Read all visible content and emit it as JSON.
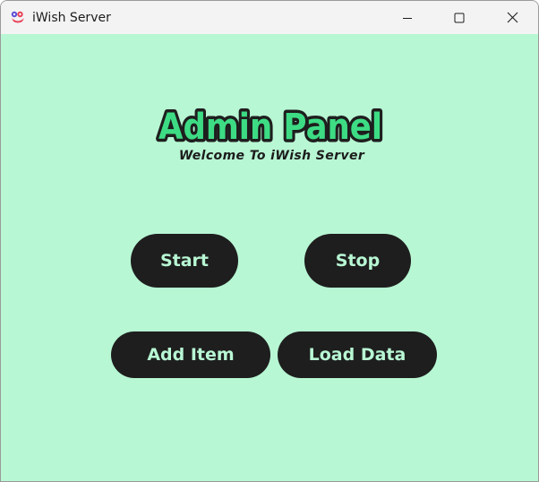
{
  "window": {
    "title": "iWish Server",
    "controls": [
      "minimize-icon",
      "maximize-icon",
      "close-icon"
    ]
  },
  "header": {
    "title": "Admin Panel",
    "subtitle": "Welcome To iWish Server"
  },
  "buttons": {
    "start": "Start",
    "stop": "Stop",
    "add_item": "Add Item",
    "load_data": "Load Data"
  },
  "colors": {
    "background": "#b8f7d4",
    "button_fill": "#1e1e1e",
    "button_text": "#b8f7d4",
    "title_fill": "#3ddc84",
    "title_outline": "#1e1e1e",
    "titlebar": "#f3f3f3"
  }
}
